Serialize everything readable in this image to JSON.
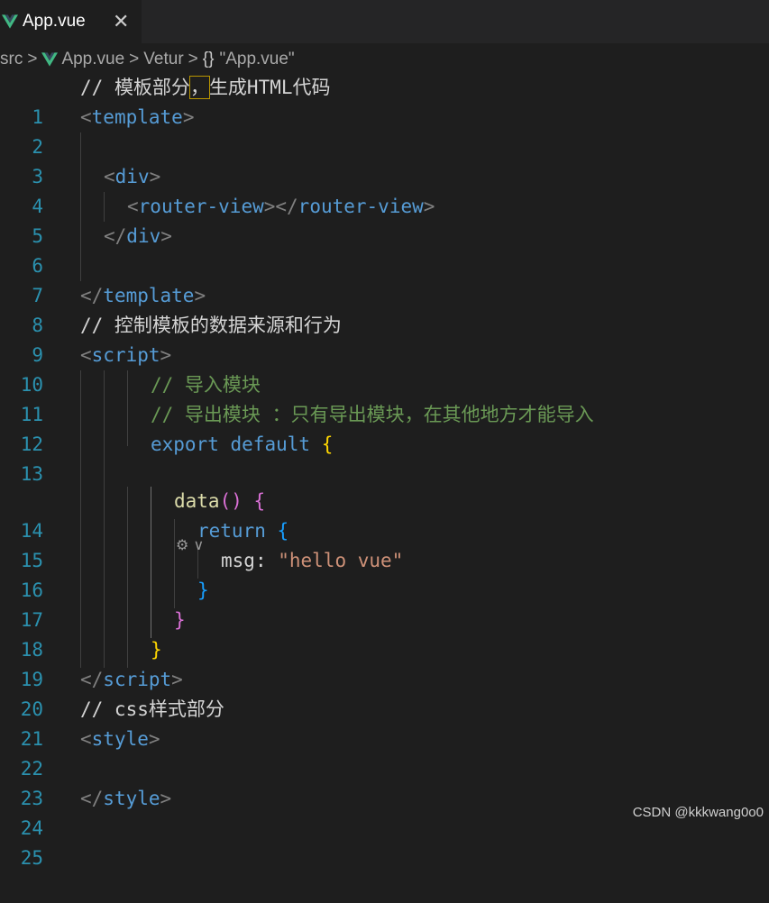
{
  "tab": {
    "label": "App.vue",
    "close": "✕"
  },
  "breadcrumb": {
    "items": [
      "src",
      "App.vue",
      "Vetur",
      "\"App.vue\""
    ],
    "sep": ">",
    "braces": "{}"
  },
  "lines": {
    "l1": {
      "num": "1",
      "comment_prefix": "// ",
      "text_a": "模板部分",
      "text_b": "，",
      "text_c": "生成HTML代码"
    },
    "l2": {
      "num": "2",
      "open": "<",
      "tag": "template",
      "close": ">"
    },
    "l3": {
      "num": "3"
    },
    "l4": {
      "num": "4",
      "open": "<",
      "tag": "div",
      "close": ">"
    },
    "l5": {
      "num": "5",
      "open": "<",
      "tag": "router-view",
      "mid": "></",
      "tag2": "router-view",
      "close": ">"
    },
    "l6": {
      "num": "6",
      "open": "</",
      "tag": "div",
      "close": ">"
    },
    "l7": {
      "num": "7"
    },
    "l8": {
      "num": "8",
      "open": "</",
      "tag": "template",
      "close": ">"
    },
    "l9": {
      "num": "9",
      "text": "// 控制模板的数据来源和行为"
    },
    "l10": {
      "num": "10",
      "open": "<",
      "tag": "script",
      "close": ">"
    },
    "l11": {
      "num": "11",
      "text": "// 导入模块"
    },
    "l12": {
      "num": "12",
      "text": "// 导出模块 ：只有导出模块，在其他地方才能导入"
    },
    "l13": {
      "num": "13",
      "kw": "export",
      "kw2": "default",
      "brace": "{"
    },
    "l14": {
      "num": "14",
      "fn": "data",
      "parens": "()",
      "brace": "{"
    },
    "l15": {
      "num": "15",
      "kw": "return",
      "brace": "{"
    },
    "l16": {
      "num": "16",
      "prop": "msg",
      "colon": ": ",
      "str": "\"hello vue\""
    },
    "l17": {
      "num": "17",
      "brace": "}"
    },
    "l18": {
      "num": "18",
      "brace": "}"
    },
    "l19": {
      "num": "19",
      "brace": "}"
    },
    "l20": {
      "num": "20",
      "open": "</",
      "tag": "script",
      "close": ">"
    },
    "l21": {
      "num": "21",
      "prefix": "// css",
      "text": "样式部分"
    },
    "l22": {
      "num": "22",
      "open": "<",
      "tag": "style",
      "close": ">"
    },
    "l23": {
      "num": "23"
    },
    "l24": {
      "num": "24",
      "open": "</",
      "tag": "style",
      "close": ">"
    },
    "l25": {
      "num": "25"
    }
  },
  "codelens": {
    "icon": "⚙",
    "chevron": "∨"
  },
  "watermark": "CSDN @kkkwang0o0",
  "colors": {
    "background": "#1e1e1e",
    "line_number": "#2b91af",
    "tag": "#569cd6",
    "comment": "#6a9955",
    "string": "#ce9178",
    "function": "#dcdcaa",
    "property": "#9cdcfe",
    "bracket_gold": "#ffd700",
    "bracket_purple": "#da70d6",
    "bracket_blue": "#179fff",
    "vue_green": "#41b883"
  },
  "icons": {
    "tab": "vue-logo-icon",
    "close": "close-icon",
    "codelens": "codelens-icon"
  }
}
